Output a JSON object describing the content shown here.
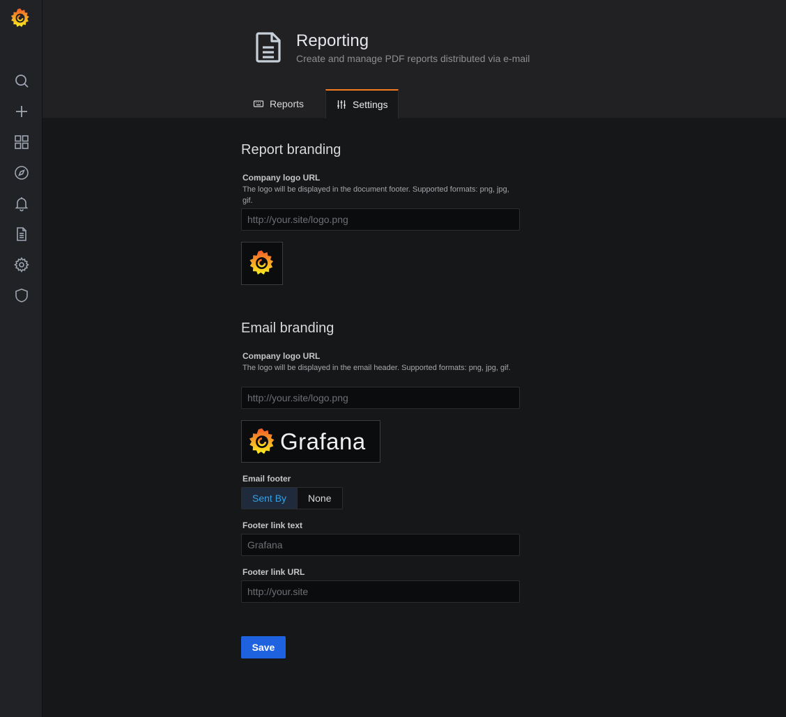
{
  "header": {
    "title": "Reporting",
    "subtitle": "Create and manage PDF reports distributed via e-mail",
    "icon": "document-icon"
  },
  "tabs": [
    {
      "label": "Reports",
      "icon": "keyboard-icon",
      "active": false
    },
    {
      "label": "Settings",
      "icon": "sliders-icon",
      "active": true
    }
  ],
  "sidebar": {
    "logo": "grafana-logo",
    "items": [
      {
        "icon": "search-icon"
      },
      {
        "icon": "plus-icon"
      },
      {
        "icon": "dashboards-icon"
      },
      {
        "icon": "compass-icon"
      },
      {
        "icon": "bell-icon"
      },
      {
        "icon": "document-icon"
      },
      {
        "icon": "gear-icon"
      },
      {
        "icon": "shield-icon"
      }
    ]
  },
  "report_branding": {
    "heading": "Report branding",
    "logo_label": "Company logo URL",
    "logo_desc": "The logo will be displayed in the document footer. Supported formats: png, jpg, gif.",
    "logo_placeholder": "http://your.site/logo.png"
  },
  "email_branding": {
    "heading": "Email branding",
    "logo_label": "Company logo URL",
    "logo_desc": "The logo will be displayed in the email header. Supported formats: png, jpg, gif.",
    "logo_placeholder": "http://your.site/logo.png",
    "preview_wordmark": "Grafana",
    "footer_label": "Email footer",
    "footer_options": [
      "Sent By",
      "None"
    ],
    "footer_selected": "Sent By",
    "link_text_label": "Footer link text",
    "link_text_placeholder": "Grafana",
    "link_url_label": "Footer link URL",
    "link_url_placeholder": "http://your.site"
  },
  "save_label": "Save",
  "colors": {
    "accent": "#f57c1f",
    "primary_button": "#1f62e0",
    "active_radio_text": "#33a2e5"
  }
}
